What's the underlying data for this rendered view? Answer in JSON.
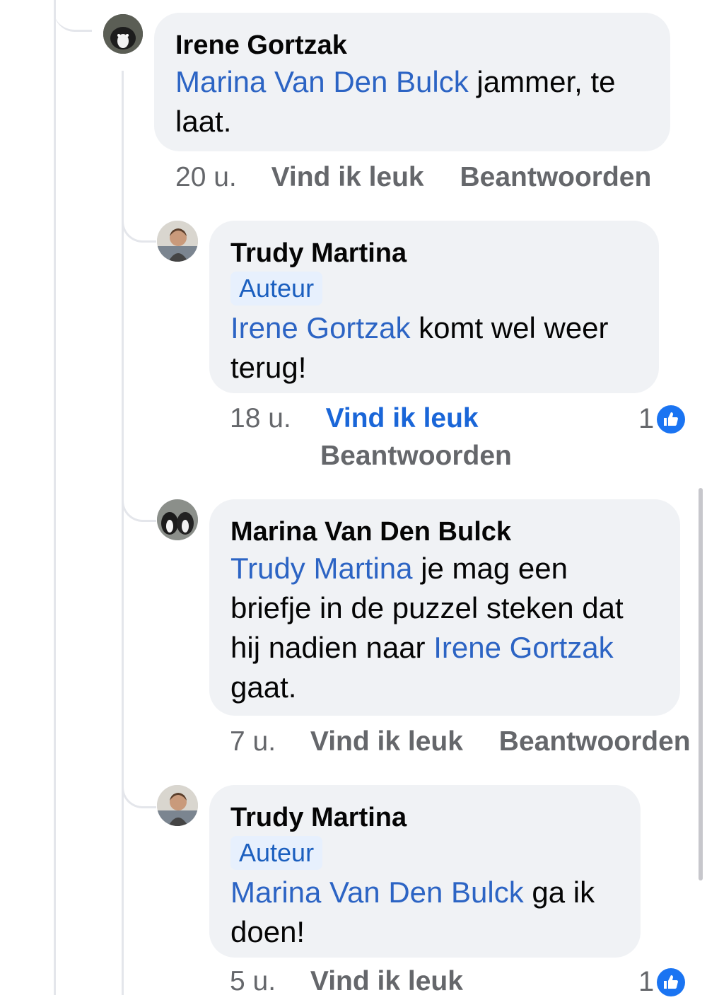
{
  "comments": [
    {
      "author": "Irene Gortzak",
      "mention": "Marina Van Den Bulck",
      "text_line1_rest": " jammer, te",
      "text_line2": "laat.",
      "time": "20 u.",
      "like_label": "Vind ik leuk",
      "reply_label": "Beantwoorden"
    },
    {
      "author": "Trudy Martina",
      "badge": "Auteur",
      "mention": "Irene Gortzak",
      "text_line1_rest": " komt wel weer",
      "text_line2": "terug!",
      "time": "18 u.",
      "like_label": "Vind ik leuk",
      "reply_label": "Beantwoorden",
      "reaction_count": "1"
    },
    {
      "author": "Marina Van Den Bulck",
      "mention": "Trudy Martina",
      "text_line1_rest": " je mag een",
      "text_line2": "briefje in de puzzel steken dat",
      "text_line3_pre": "hij nadien naar ",
      "mention2": "Irene Gortzak",
      "text_line4": "gaat.",
      "time": "7 u.",
      "like_label": "Vind ik leuk",
      "reply_label": "Beantwoorden"
    },
    {
      "author": "Trudy Martina",
      "badge": "Auteur",
      "mention": "Marina Van Den Bulck",
      "text_line1_rest": " ga ik",
      "text_line2": "doen!",
      "time": "5 u.",
      "like_label": "Vind ik leuk",
      "reaction_count": "1"
    }
  ],
  "colors": {
    "mention": "#2c64c4",
    "bubble": "#f0f2f5",
    "like_active": "#1a66d8",
    "like_icon": "#1a74f2"
  },
  "icons": {
    "reaction": "thumbs-up-icon"
  }
}
